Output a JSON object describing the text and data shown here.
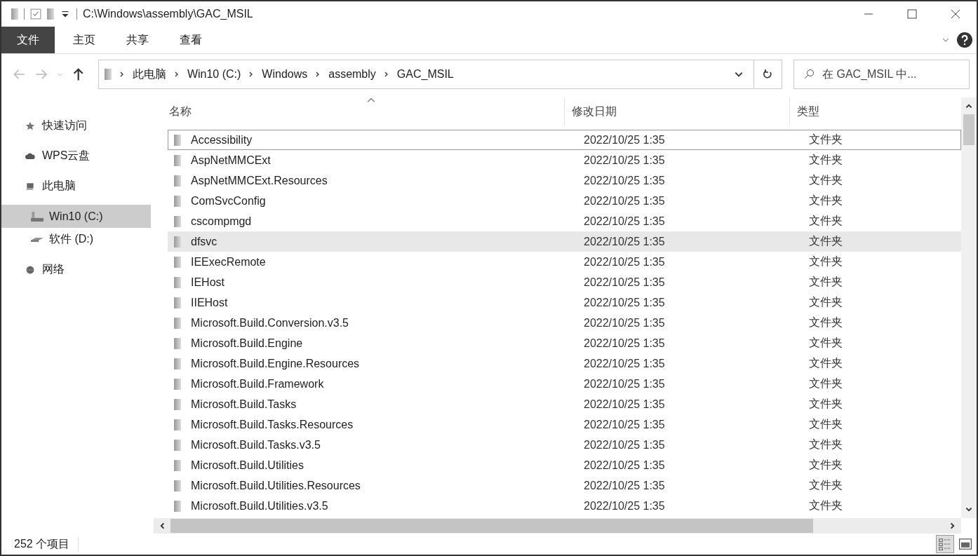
{
  "window": {
    "title": "C:\\Windows\\assembly\\GAC_MSIL"
  },
  "ribbon_tabs": [
    {
      "label": "文件",
      "selected": true
    },
    {
      "label": "主页",
      "selected": false
    },
    {
      "label": "共享",
      "selected": false
    },
    {
      "label": "查看",
      "selected": false
    }
  ],
  "address_bar": {
    "breadcrumbs": [
      "此电脑",
      "Win10 (C:)",
      "Windows",
      "assembly",
      "GAC_MSIL"
    ]
  },
  "search": {
    "placeholder": "在 GAC_MSIL 中..."
  },
  "sidebar": {
    "items": [
      {
        "label": "快速访问",
        "kind": "star",
        "selected": false
      },
      {
        "label": "WPS云盘",
        "kind": "cloud",
        "selected": false
      },
      {
        "label": "此电脑",
        "kind": "computer",
        "selected": false,
        "children": [
          {
            "label": "Win10 (C:)",
            "kind": "system-drive",
            "selected": true
          },
          {
            "label": "软件 (D:)",
            "kind": "drive",
            "selected": false
          }
        ]
      },
      {
        "label": "网络",
        "kind": "network",
        "selected": false
      }
    ]
  },
  "table": {
    "columns": [
      "名称",
      "修改日期",
      "类型"
    ],
    "rows": [
      {
        "name": "Accessibility",
        "date": "2022/10/25 1:35",
        "type": "文件夹",
        "focused": true,
        "hovered": false
      },
      {
        "name": "AspNetMMCExt",
        "date": "2022/10/25 1:35",
        "type": "文件夹",
        "focused": false,
        "hovered": false
      },
      {
        "name": "AspNetMMCExt.Resources",
        "date": "2022/10/25 1:35",
        "type": "文件夹",
        "focused": false,
        "hovered": false
      },
      {
        "name": "ComSvcConfig",
        "date": "2022/10/25 1:35",
        "type": "文件夹",
        "focused": false,
        "hovered": false
      },
      {
        "name": "cscompmgd",
        "date": "2022/10/25 1:35",
        "type": "文件夹",
        "focused": false,
        "hovered": false
      },
      {
        "name": "dfsvc",
        "date": "2022/10/25 1:35",
        "type": "文件夹",
        "focused": false,
        "hovered": true
      },
      {
        "name": "IEExecRemote",
        "date": "2022/10/25 1:35",
        "type": "文件夹",
        "focused": false,
        "hovered": false
      },
      {
        "name": "IEHost",
        "date": "2022/10/25 1:35",
        "type": "文件夹",
        "focused": false,
        "hovered": false
      },
      {
        "name": "IIEHost",
        "date": "2022/10/25 1:35",
        "type": "文件夹",
        "focused": false,
        "hovered": false
      },
      {
        "name": "Microsoft.Build.Conversion.v3.5",
        "date": "2022/10/25 1:35",
        "type": "文件夹",
        "focused": false,
        "hovered": false
      },
      {
        "name": "Microsoft.Build.Engine",
        "date": "2022/10/25 1:35",
        "type": "文件夹",
        "focused": false,
        "hovered": false
      },
      {
        "name": "Microsoft.Build.Engine.Resources",
        "date": "2022/10/25 1:35",
        "type": "文件夹",
        "focused": false,
        "hovered": false
      },
      {
        "name": "Microsoft.Build.Framework",
        "date": "2022/10/25 1:35",
        "type": "文件夹",
        "focused": false,
        "hovered": false
      },
      {
        "name": "Microsoft.Build.Tasks",
        "date": "2022/10/25 1:35",
        "type": "文件夹",
        "focused": false,
        "hovered": false
      },
      {
        "name": "Microsoft.Build.Tasks.Resources",
        "date": "2022/10/25 1:35",
        "type": "文件夹",
        "focused": false,
        "hovered": false
      },
      {
        "name": "Microsoft.Build.Tasks.v3.5",
        "date": "2022/10/25 1:35",
        "type": "文件夹",
        "focused": false,
        "hovered": false
      },
      {
        "name": "Microsoft.Build.Utilities",
        "date": "2022/10/25 1:35",
        "type": "文件夹",
        "focused": false,
        "hovered": false
      },
      {
        "name": "Microsoft.Build.Utilities.Resources",
        "date": "2022/10/25 1:35",
        "type": "文件夹",
        "focused": false,
        "hovered": false
      },
      {
        "name": "Microsoft.Build.Utilities.v3.5",
        "date": "2022/10/25 1:35",
        "type": "文件夹",
        "focused": false,
        "hovered": false
      }
    ]
  },
  "status_bar": {
    "item_count": "252 个项目"
  }
}
